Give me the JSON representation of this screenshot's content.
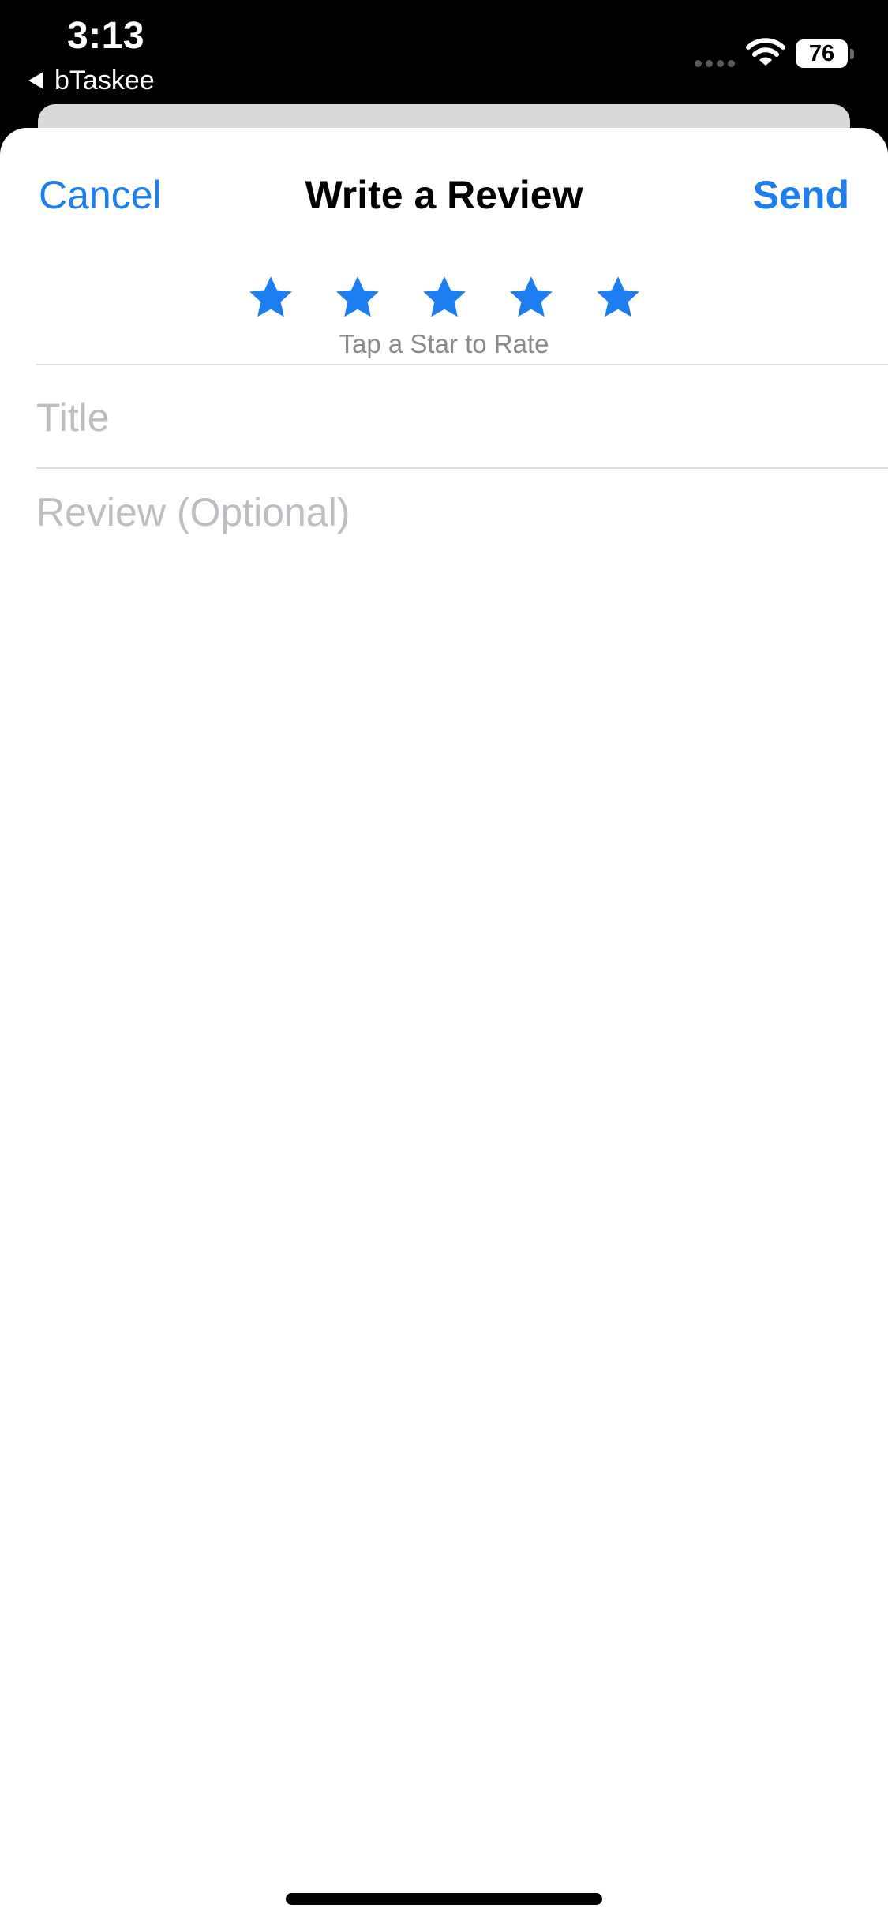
{
  "status_bar": {
    "time": "3:13",
    "back_app": "bTaskee",
    "battery": "76"
  },
  "nav": {
    "cancel": "Cancel",
    "title": "Write a Review",
    "send": "Send"
  },
  "rating": {
    "star_count": 5,
    "hint": "Tap a Star to Rate",
    "color": "#1c7ef0"
  },
  "form": {
    "title_placeholder": "Title",
    "review_placeholder": "Review (Optional)"
  },
  "colors": {
    "accent": "#1c7ef0",
    "placeholder": "#bdbdc2"
  }
}
